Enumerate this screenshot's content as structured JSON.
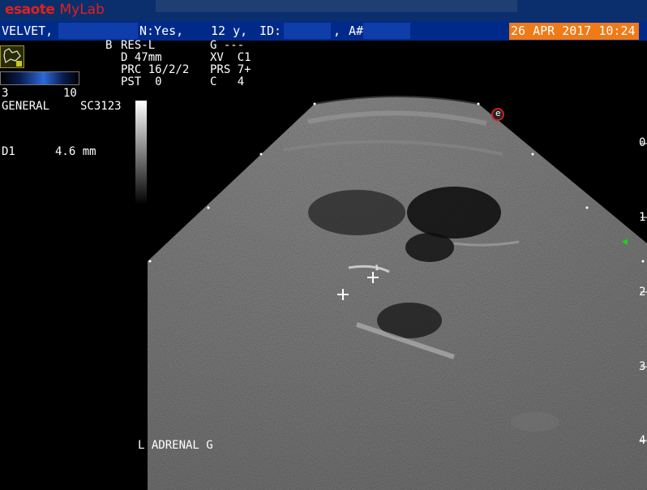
{
  "header": {
    "brand_e": "esaote",
    "brand_mylab": "MyLab",
    "patient_name": "VELVET,",
    "neutered": "N:Yes,",
    "age": "12 y,",
    "id_label": "ID:",
    "sep": ",",
    "acc_label": "A#",
    "date": "26 APR 2017 10:24"
  },
  "params": {
    "mode": "B",
    "res": "RES-L",
    "gain": "G ---",
    "depth": "D 47mm",
    "xv": "XV  C1",
    "prc": "PRC 16/2/2",
    "prs": "PRS 7+",
    "pst": "PST  0",
    "c": "C   4"
  },
  "colormap_range": {
    "min": "3",
    "max": "10"
  },
  "preset": "GENERAL",
  "probe": "SC3123",
  "measurement": {
    "label": "D1",
    "value": "4.6 mm"
  },
  "caliper_index": "1",
  "body_mark": "L ADRENAL G",
  "depth_scale": [
    "0",
    "1",
    "2",
    "3",
    "4"
  ],
  "orientation_marker": "e",
  "colors": {
    "topbar": "#0b2f6c",
    "patient_row": "#002a8a",
    "date_bg": "#f07a17",
    "brand": "#e02020",
    "focus_marker": "#20d020"
  }
}
